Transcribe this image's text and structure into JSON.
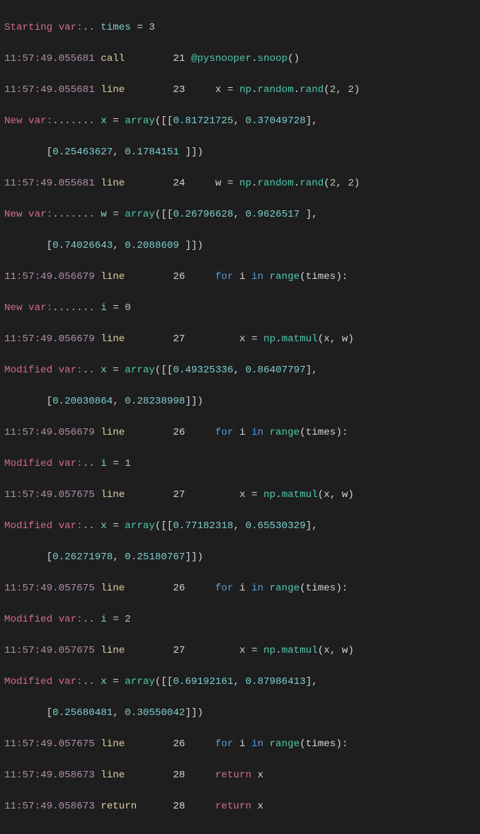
{
  "colors": {
    "bg": "#1e1e1e",
    "timestamp": "#b48ead",
    "cyan": "#7ecfcf",
    "event": "#e0cfa0",
    "default": "#d4d4d4",
    "keyword": "#569cd6",
    "teal": "#4ec9b0",
    "number": "#b5cea8",
    "pink": "#d16d92"
  },
  "l00": {
    "a": "Starting var:",
    "b": ".. ",
    "c": "times ",
    "d": "= ",
    "e": "3"
  },
  "l01": {
    "ts": "11:57:49.055681 ",
    "ev": "call     ",
    "ln": "   21 ",
    "at": "@",
    "mod": "pysnooper",
    "dot": ".",
    "fn": "snoop",
    "par": "()"
  },
  "l02": {
    "ts": "11:57:49.055681 ",
    "ev": "line     ",
    "ln": "   23 ",
    "pad": "    ",
    "x": "x ",
    "eq": "= ",
    "np": "np",
    "d1": ".",
    "rnd": "random",
    "d2": ".",
    "rand": "rand",
    "lp": "(",
    "a": "2",
    "c": ", ",
    "b": "2",
    "rp": ")"
  },
  "l03": {
    "a": "New var:",
    "b": "....... ",
    "c": "x ",
    "d": "= ",
    "e": "array",
    "f": "([[",
    "g": "0.81721725",
    "h": ", ",
    "i": "0.37049728",
    "j": "],"
  },
  "l04": {
    "pad": "       [",
    "a": "0.25463627",
    "c": ", ",
    "b": "0.1784151 ",
    "rp": "]])"
  },
  "l05": {
    "ts": "11:57:49.055681 ",
    "ev": "line     ",
    "ln": "   24 ",
    "pad": "    ",
    "x": "w ",
    "eq": "= ",
    "np": "np",
    "d1": ".",
    "rnd": "random",
    "d2": ".",
    "rand": "rand",
    "lp": "(",
    "a": "2",
    "c": ", ",
    "b": "2",
    "rp": ")"
  },
  "l06": {
    "a": "New var:",
    "b": "....... ",
    "c": "w ",
    "d": "= ",
    "e": "array",
    "f": "([[",
    "g": "0.26796628",
    "h": ", ",
    "i": "0.9626517 ",
    "j": "],"
  },
  "l07": {
    "pad": "       [",
    "a": "0.74026643",
    "c": ", ",
    "b": "0.2088609 ",
    "rp": "]])"
  },
  "l08": {
    "ts": "11:57:49.056679 ",
    "ev": "line     ",
    "ln": "   26 ",
    "pad": "    ",
    "for": "for ",
    "i": "i ",
    "in": "in ",
    "rng": "range",
    "lp": "(",
    "t": "times",
    "rp": "):"
  },
  "l09": {
    "a": "New var:",
    "b": "....... ",
    "c": "i ",
    "d": "= ",
    "e": "0"
  },
  "l10": {
    "ts": "11:57:49.056679 ",
    "ev": "line     ",
    "ln": "   27 ",
    "pad": "        ",
    "x": "x ",
    "eq": "= ",
    "np": "np",
    "d1": ".",
    "mm": "matmul",
    "lp": "(",
    "a": "x",
    "c": ", ",
    "b": "w",
    "rp": ")"
  },
  "l11": {
    "a": "Modified var:",
    "b": ".. ",
    "c": "x ",
    "d": "= ",
    "e": "array",
    "f": "([[",
    "g": "0.49325336",
    "h": ", ",
    "i": "0.86407797",
    "j": "],"
  },
  "l12": {
    "pad": "       [",
    "a": "0.20030864",
    "c": ", ",
    "b": "0.28238998",
    "rp": "]])"
  },
  "l13": {
    "ts": "11:57:49.056679 ",
    "ev": "line     ",
    "ln": "   26 ",
    "pad": "    ",
    "for": "for ",
    "i": "i ",
    "in": "in ",
    "rng": "range",
    "lp": "(",
    "t": "times",
    "rp": "):"
  },
  "l14": {
    "a": "Modified var:",
    "b": ".. ",
    "c": "i ",
    "d": "= ",
    "e": "1"
  },
  "l15": {
    "ts": "11:57:49.057675 ",
    "ev": "line     ",
    "ln": "   27 ",
    "pad": "        ",
    "x": "x ",
    "eq": "= ",
    "np": "np",
    "d1": ".",
    "mm": "matmul",
    "lp": "(",
    "a": "x",
    "c": ", ",
    "b": "w",
    "rp": ")"
  },
  "l16": {
    "a": "Modified var:",
    "b": ".. ",
    "c": "x ",
    "d": "= ",
    "e": "array",
    "f": "([[",
    "g": "0.77182318",
    "h": ", ",
    "i": "0.65530329",
    "j": "],"
  },
  "l17": {
    "pad": "       [",
    "a": "0.26271978",
    "c": ", ",
    "b": "0.25180767",
    "rp": "]])"
  },
  "l18": {
    "ts": "11:57:49.057675 ",
    "ev": "line     ",
    "ln": "   26 ",
    "pad": "    ",
    "for": "for ",
    "i": "i ",
    "in": "in ",
    "rng": "range",
    "lp": "(",
    "t": "times",
    "rp": "):"
  },
  "l19": {
    "a": "Modified var:",
    "b": ".. ",
    "c": "i ",
    "d": "= ",
    "e": "2"
  },
  "l20": {
    "ts": "11:57:49.057675 ",
    "ev": "line     ",
    "ln": "   27 ",
    "pad": "        ",
    "x": "x ",
    "eq": "= ",
    "np": "np",
    "d1": ".",
    "mm": "matmul",
    "lp": "(",
    "a": "x",
    "c": ", ",
    "b": "w",
    "rp": ")"
  },
  "l21": {
    "a": "Modified var:",
    "b": ".. ",
    "c": "x ",
    "d": "= ",
    "e": "array",
    "f": "([[",
    "g": "0.69192161",
    "h": ", ",
    "i": "0.87986413",
    "j": "],"
  },
  "l22": {
    "pad": "       [",
    "a": "0.25680481",
    "c": ", ",
    "b": "0.30550042",
    "rp": "]])"
  },
  "l23": {
    "ts": "11:57:49.057675 ",
    "ev": "line     ",
    "ln": "   26 ",
    "pad": "    ",
    "for": "for ",
    "i": "i ",
    "in": "in ",
    "rng": "range",
    "lp": "(",
    "t": "times",
    "rp": "):"
  },
  "l24": {
    "ts": "11:57:49.058673 ",
    "ev": "line     ",
    "ln": "   28 ",
    "pad": "    ",
    "ret": "return ",
    "x": "x"
  },
  "l25": {
    "ts": "11:57:49.058673 ",
    "ev": "return   ",
    "ln": "   28 ",
    "pad": "    ",
    "ret": "return ",
    "x": "x"
  }
}
